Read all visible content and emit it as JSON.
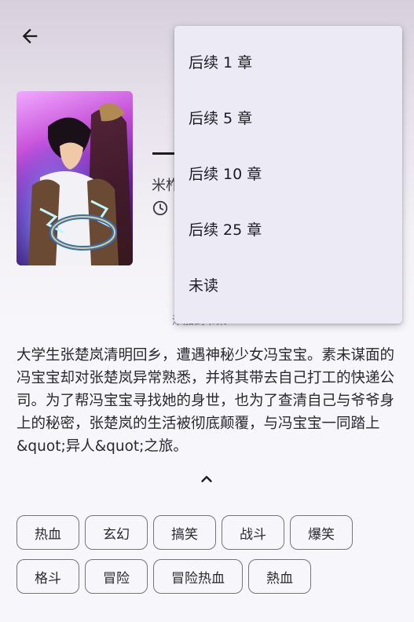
{
  "header": {
    "back_icon": "arrow-back-icon"
  },
  "manga": {
    "author_partial": "米柞",
    "add_to_library_partial": "添加到书架",
    "description": "大学生张楚岚清明回乡，遭遇神秘少女冯宝宝。素未谋面的冯宝宝却对张楚岚异常熟悉，并将其带去自己打工的快递公司。为了帮冯宝宝寻找她的身世，也为了查清自己与爷爷身上的秘密，张楚岚的生活被彻底颠覆，与冯宝宝一同踏上&quot;异人&quot;之旅。",
    "status_icon": "clock-icon",
    "collapse_icon": "chevron-up-icon",
    "tags": [
      "热血",
      "玄幻",
      "搞笑",
      "战斗",
      "爆笑",
      "格斗",
      "冒险",
      "冒险热血",
      "熱血"
    ]
  },
  "download_menu": {
    "items": [
      "后续 1 章",
      "后续 5 章",
      "后续 10 章",
      "后续 25 章",
      "未读"
    ]
  },
  "colors": {
    "background": "#f7f6fb",
    "menu_background": "#eceaf4",
    "tag_border": "#77737e"
  }
}
